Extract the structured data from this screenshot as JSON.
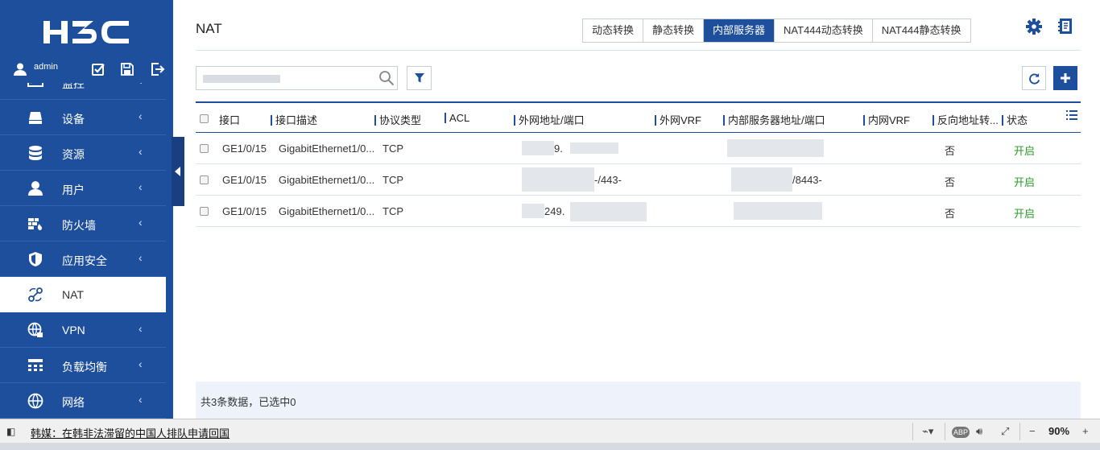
{
  "sidebar": {
    "logo_text": "H3C",
    "user": "admin",
    "items": [
      {
        "label": "监控",
        "icon": "monitor-icon",
        "active": false
      },
      {
        "label": "设备",
        "icon": "device-icon",
        "active": false
      },
      {
        "label": "资源",
        "icon": "database-icon",
        "active": false
      },
      {
        "label": "用户",
        "icon": "user-icon",
        "active": false
      },
      {
        "label": "防火墙",
        "icon": "firewall-icon",
        "active": false
      },
      {
        "label": "应用安全",
        "icon": "shield-icon",
        "active": false
      },
      {
        "label": "NAT",
        "icon": "nat-icon",
        "active": true
      },
      {
        "label": "VPN",
        "icon": "vpn-globe-icon",
        "active": false
      },
      {
        "label": "负载均衡",
        "icon": "load-balance-icon",
        "active": false
      },
      {
        "label": "网络",
        "icon": "network-globe-icon",
        "active": false
      }
    ],
    "arrow": "‹"
  },
  "main": {
    "title": "NAT",
    "tabs": [
      {
        "label": "动态转换",
        "active": false
      },
      {
        "label": "静态转换",
        "active": false
      },
      {
        "label": "内部服务器",
        "active": true
      },
      {
        "label": "NAT444动态转换",
        "active": false
      },
      {
        "label": "NAT444静态转换",
        "active": false
      }
    ],
    "search": {
      "value": "",
      "placeholder": ""
    }
  },
  "table": {
    "headers": {
      "interface": "接口",
      "interface_desc": "接口描述",
      "protocol": "协议类型",
      "acl": "ACL",
      "public_addr": "外网地址/端口",
      "public_vrf": "外网VRF",
      "internal_addr": "内部服务器地址/端口",
      "internal_vrf": "内网VRF",
      "reverse": "反向地址转...",
      "status": "状态"
    },
    "rows": [
      {
        "interface": "GE1/0/15",
        "interface_desc": "GigabitEthernet1/0...",
        "protocol": "TCP",
        "public_addr": "9.",
        "internal_addr": "",
        "reverse": "否",
        "status": "开启"
      },
      {
        "interface": "GE1/0/15",
        "interface_desc": "GigabitEthernet1/0...",
        "protocol": "TCP",
        "public_addr": "-/443-",
        "internal_addr": "/8443-",
        "reverse": "否",
        "status": "开启"
      },
      {
        "interface": "GE1/0/15",
        "interface_desc": "GigabitEthernet1/0...",
        "protocol": "TCP",
        "public_addr": "249.",
        "internal_addr": "",
        "reverse": "否",
        "status": "开启"
      }
    ],
    "footer": "共3条数据，已选中0"
  },
  "browser": {
    "news": "韩媒：在韩非法滞留的中国人排队申请回国",
    "zoom": "90%"
  },
  "colors": {
    "brand": "#1e4f9c",
    "status_on": "#2a9b2a"
  }
}
